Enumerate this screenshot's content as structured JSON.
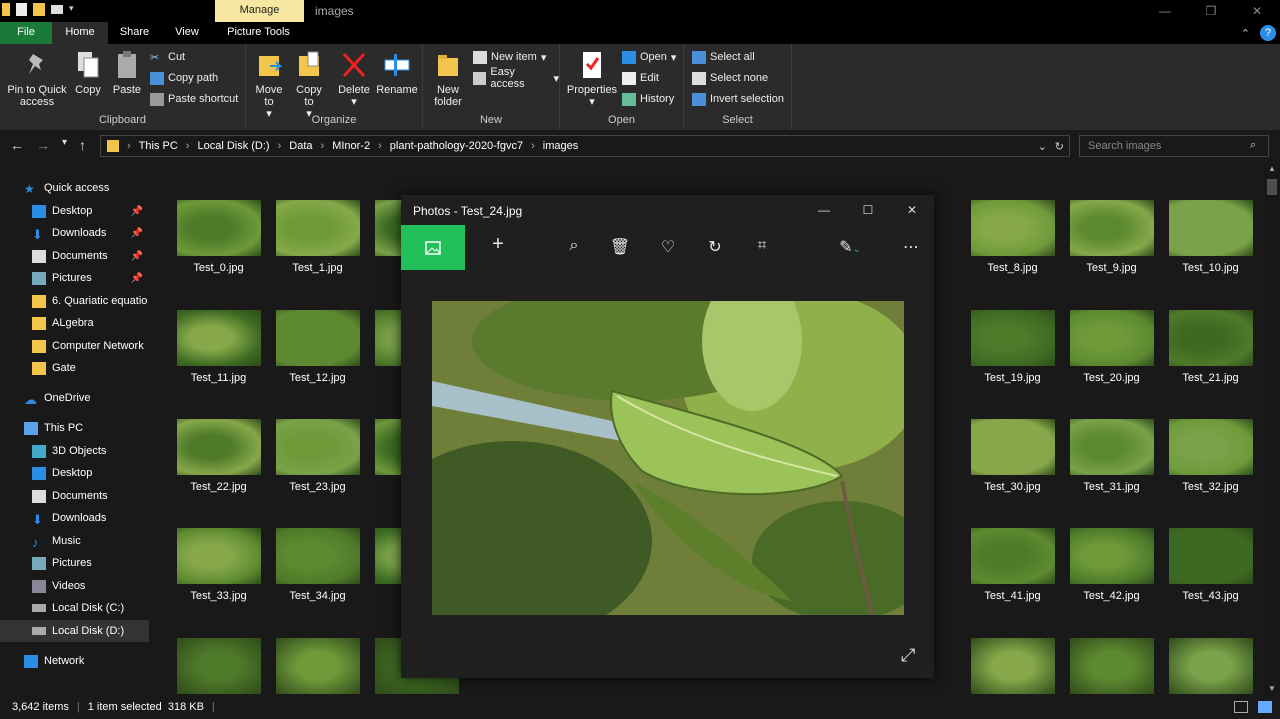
{
  "titlebar": {
    "manage_label": "Manage",
    "window_title": "images"
  },
  "tabs": {
    "file": "File",
    "home": "Home",
    "share": "Share",
    "view": "View",
    "picture_tools": "Picture Tools"
  },
  "ribbon": {
    "clipboard": {
      "pin": "Pin to Quick access",
      "copy": "Copy",
      "paste": "Paste",
      "cut": "Cut",
      "copy_path": "Copy path",
      "paste_shortcut": "Paste shortcut",
      "label": "Clipboard"
    },
    "organize": {
      "move_to": "Move to",
      "copy_to": "Copy to",
      "delete": "Delete",
      "rename": "Rename",
      "label": "Organize"
    },
    "new": {
      "new_folder": "New folder",
      "new_item": "New item",
      "easy_access": "Easy access",
      "label": "New"
    },
    "open": {
      "properties": "Properties",
      "open": "Open",
      "edit": "Edit",
      "history": "History",
      "label": "Open"
    },
    "select": {
      "select_all": "Select all",
      "select_none": "Select none",
      "invert": "Invert selection",
      "label": "Select"
    }
  },
  "address": {
    "crumbs": [
      "This PC",
      "Local Disk (D:)",
      "Data",
      "MInor-2",
      "plant-pathology-2020-fgvc7",
      "images"
    ],
    "search_placeholder": "Search images"
  },
  "nav": {
    "quick_access": "Quick access",
    "quick_items": [
      "Desktop",
      "Downloads",
      "Documents",
      "Pictures",
      "6. Quariatic equatio",
      "ALgebra",
      "Computer Network",
      "Gate"
    ],
    "onedrive": "OneDrive",
    "this_pc": "This PC",
    "pc_items": [
      "3D Objects",
      "Desktop",
      "Documents",
      "Downloads",
      "Music",
      "Pictures",
      "Videos",
      "Local Disk (C:)",
      "Local Disk (D:)"
    ],
    "network": "Network"
  },
  "files": [
    [
      "Test_0.jpg",
      "Test_1.jpg",
      "Tes",
      "Test_8.jpg",
      "Test_9.jpg",
      "Test_10.jpg"
    ],
    [
      "Test_11.jpg",
      "Test_12.jpg",
      "Test",
      "Test_19.jpg",
      "Test_20.jpg",
      "Test_21.jpg"
    ],
    [
      "Test_22.jpg",
      "Test_23.jpg",
      "Test",
      "Test_30.jpg",
      "Test_31.jpg",
      "Test_32.jpg"
    ],
    [
      "Test_33.jpg",
      "Test_34.jpg",
      "Test",
      "Test_41.jpg",
      "Test_42.jpg",
      "Test_43.jpg"
    ]
  ],
  "status": {
    "items": "3,642 items",
    "selected": "1 item selected  318 KB"
  },
  "photos": {
    "title": "Photos - Test_24.jpg"
  },
  "colors": {
    "accent_green": "#21c05a",
    "file_tab": "#1b7a3a",
    "manage_tab": "#f7e7a1"
  }
}
